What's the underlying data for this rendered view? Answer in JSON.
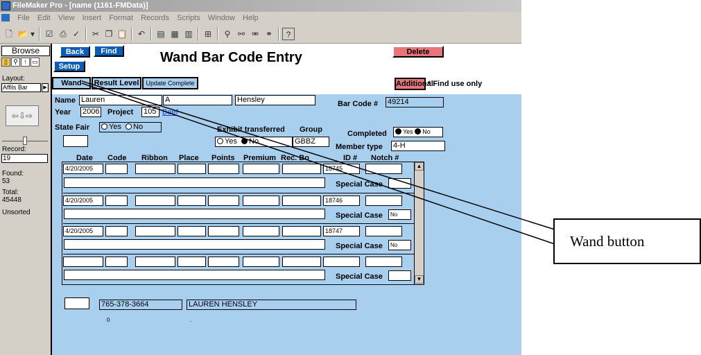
{
  "window": {
    "title": "FileMaker Pro - [name (1161-FMData)]"
  },
  "menu": [
    "File",
    "Edit",
    "View",
    "Insert",
    "Format",
    "Records",
    "Scripts",
    "Window",
    "Help"
  ],
  "toolbar_icons": [
    "new-file-icon",
    "open-folder-icon",
    "dropdown-arrow-icon",
    "checkbox-icon",
    "print-icon",
    "spellcheck-icon",
    "cut-icon",
    "copy-icon",
    "paste-icon",
    "undo-icon",
    "sort-icon",
    "new-record-icon",
    "delete-record-icon",
    "import-icon",
    "find-icon",
    "find-all-icon",
    "omit-icon",
    "show-all-icon",
    "help-icon"
  ],
  "status": {
    "mode": "Browse",
    "layout_label": "Layout:",
    "layout_value": "Affils Bar",
    "record_label": "Record:",
    "record_value": "19",
    "found_label": "Found:",
    "found_value": "53",
    "total_label": "Total:",
    "total_value": "45448",
    "sort_state": "Unsorted"
  },
  "header": {
    "back": "Back",
    "find": "Find",
    "setup": "Setup",
    "title": "Wand Bar Code Entry",
    "delete": "Delete",
    "wand": "Wand",
    "result_level": "Result Level",
    "update_complete": "Update Complete",
    "additional": "Additional",
    "find_note": "* Find use only"
  },
  "form": {
    "name_label": "Name",
    "first_name": "Lauren",
    "middle": "A",
    "last_name": "Hensley",
    "barcode_label": "Bar Code #",
    "barcode": "49214",
    "year_label": "Year",
    "year": "2006",
    "project_label": "Project",
    "project": "105",
    "project_link": "Beef",
    "state_fair_label": "State Fair",
    "yes": "Yes",
    "no": "No",
    "exhibit_label": "Exhibit transferred",
    "group_label": "Group",
    "group": "GBBZ",
    "completed_label": "Completed",
    "member_type_label": "Member type",
    "member_type": "4-H"
  },
  "columns": [
    "Date",
    "Code",
    "Ribbon",
    "Place",
    "Points",
    "Premium",
    "Rec. Bo",
    "ID #",
    "Notch #"
  ],
  "rows": [
    {
      "date": "4/20/2005",
      "id": "18745",
      "special_label": "Special Case",
      "special": ""
    },
    {
      "date": "4/20/2005",
      "id": "18746",
      "special_label": "Special Case",
      "special": "No"
    },
    {
      "date": "4/20/2005",
      "id": "18747",
      "special_label": "Special Case",
      "special": "No"
    },
    {
      "date": "",
      "id": "",
      "special_label": "Special Case",
      "special": ""
    }
  ],
  "footer": {
    "phone": "765-378-3664",
    "full_name": "LAUREN HENSLEY",
    "small_value": "0"
  },
  "callout": {
    "label": "Wand button"
  }
}
